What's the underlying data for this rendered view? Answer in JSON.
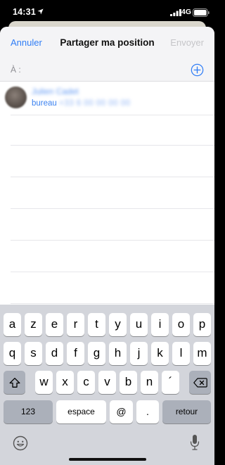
{
  "status_bar": {
    "time": "14:31",
    "network": "4G"
  },
  "nav": {
    "cancel_label": "Annuler",
    "title": "Partager ma position",
    "send_label": "Envoyer"
  },
  "to_field": {
    "label": "À :"
  },
  "contact": {
    "name": "Julien Cadet",
    "type": "bureau",
    "number": "+33 6 00 00 00 00"
  },
  "keyboard": {
    "row1": [
      "a",
      "z",
      "e",
      "r",
      "t",
      "y",
      "u",
      "i",
      "o",
      "p"
    ],
    "row2": [
      "q",
      "s",
      "d",
      "f",
      "g",
      "h",
      "j",
      "k",
      "l",
      "m"
    ],
    "row3": [
      "w",
      "x",
      "c",
      "v",
      "b",
      "n",
      "´"
    ],
    "numbers_label": "123",
    "space_label": "espace",
    "at_label": "@",
    "dot_label": ".",
    "return_label": "retour"
  },
  "colors": {
    "accent": "#2f7df6",
    "disabled": "#c5c5c8",
    "keyboard_bg": "#d3d5db"
  }
}
